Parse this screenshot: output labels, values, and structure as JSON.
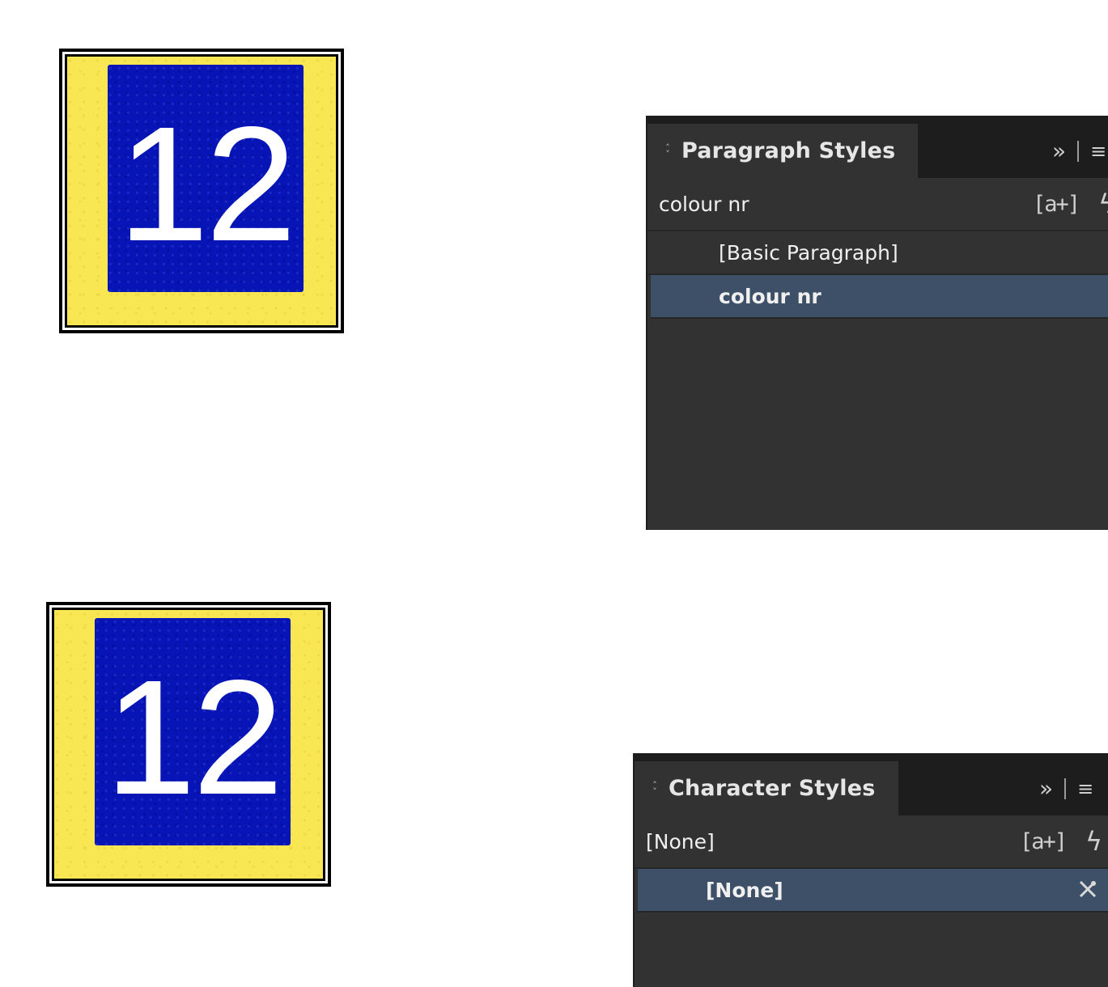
{
  "badges": [
    {
      "number": "12",
      "outer_color": "#f8e652",
      "plate_color": "#0715b6"
    },
    {
      "number": "12",
      "outer_color": "#f8e652",
      "plate_color": "#0715b6"
    }
  ],
  "paragraph_styles": {
    "title": "Paragraph Styles",
    "current_style": "colour nr",
    "collapse_icon": "double-chevron-right-icon",
    "menu_icon": "panel-menu-icon",
    "new_style_icon": "[a+]",
    "items": [
      {
        "label": "[Basic Paragraph]",
        "selected": false
      },
      {
        "label": "colour nr",
        "selected": true
      }
    ]
  },
  "character_styles": {
    "title": "Character Styles",
    "current_style": "[None]",
    "collapse_icon": "double-chevron-right-icon",
    "menu_icon": "panel-menu-icon",
    "new_style_icon": "[a+]",
    "items": [
      {
        "label": "[None]",
        "selected": true
      }
    ]
  },
  "colors": {
    "panel_bg": "#323232",
    "selection": "#3e5068"
  }
}
